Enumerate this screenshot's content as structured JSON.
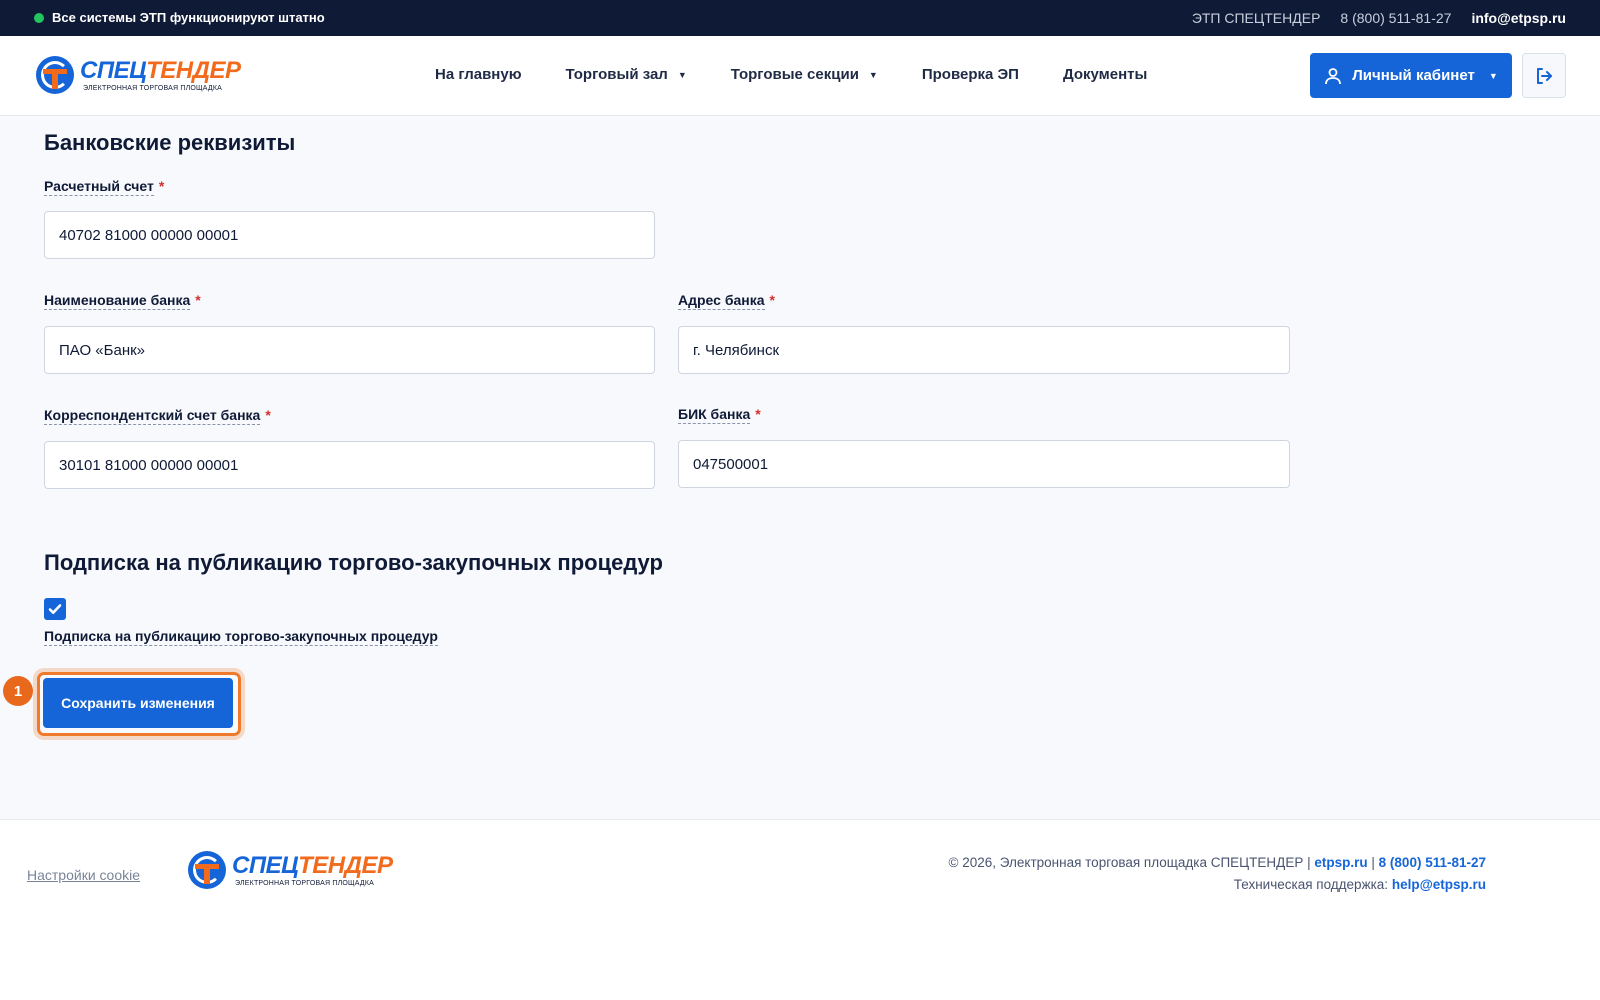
{
  "topbar": {
    "status": "Все системы ЭТП функционируют штатно",
    "site_name": "ЭТП СПЕЦТЕНДЕР",
    "phone": "8 (800) 511-81-27",
    "email": "info@etpsp.ru",
    "status_color": "#22c55e"
  },
  "logo": {
    "part1": "СПЕЦ",
    "part2": "ТЕНДЕР",
    "subtitle": "ЭЛЕКТРОННАЯ ТОРГОВАЯ ПЛОЩАДКА"
  },
  "nav": {
    "home": "На главную",
    "trading_hall": "Торговый зал",
    "trading_sections": "Торговые секции",
    "check_ep": "Проверка ЭП",
    "documents": "Документы"
  },
  "header": {
    "cabinet_label": "Личный кабинет"
  },
  "bank": {
    "title": "Банковские реквизиты",
    "account_label": "Расчетный счет",
    "account_value": "40702 81000 00000 00001",
    "bank_name_label": "Наименование банка",
    "bank_name_value": "ПАО «Банк»",
    "bank_address_label": "Адрес банка",
    "bank_address_value": "г. Челябинск",
    "corr_account_label": "Корреспондентский счет банка",
    "corr_account_value": "30101 81000 00000 00001",
    "bik_label": "БИК банка",
    "bik_value": "047500001",
    "required_mark": "*"
  },
  "subscription": {
    "title": "Подписка на публикацию торгово-закупочных процедур",
    "checkbox_label": "Подписка на публикацию торгово-закупочных процедур",
    "checked": true
  },
  "actions": {
    "save_label": "Сохранить изменения",
    "step_badge": "1"
  },
  "footer": {
    "cookie_settings": "Настройки cookie",
    "copyright": "© 2026, Электронная торговая площадка СПЕЦТЕНДЕР |",
    "site_link": "etpsp.ru",
    "separator": "|",
    "phone": "8 (800) 511-81-27",
    "support_label": "Техническая поддержка:",
    "support_email": "help@etpsp.ru"
  },
  "colors": {
    "primary": "#1565d8",
    "accent": "#f26a1b",
    "dark": "#0f1a36"
  }
}
